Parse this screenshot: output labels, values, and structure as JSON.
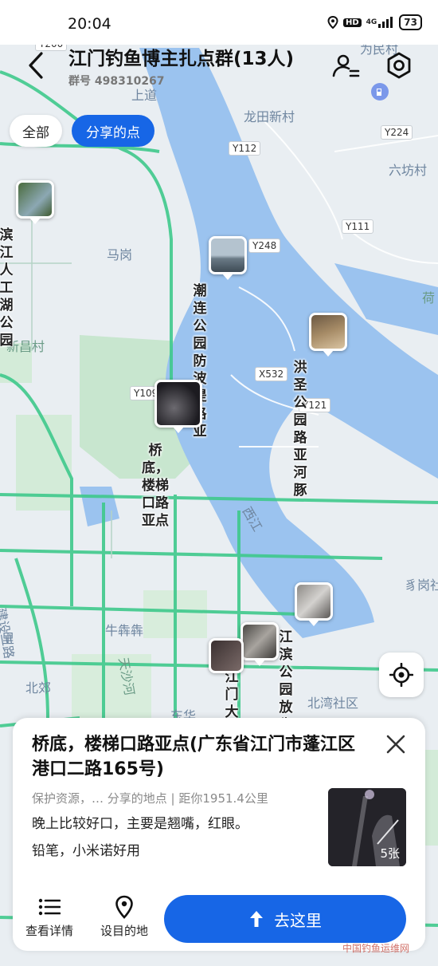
{
  "status_bar": {
    "time": "20:04",
    "network": "4G",
    "battery": "73"
  },
  "header": {
    "title": "江门钓鱼博主扎点群(13人)",
    "group_number": "群号 498310267"
  },
  "filters": {
    "all": "全部",
    "shared": "分享的点",
    "active": "shared"
  },
  "map_labels": {
    "y200": "Y200",
    "weimin": "为民村",
    "shangdao": "上道",
    "longtian": "龙田新村",
    "liufang": "六坊村",
    "y112": "Y112",
    "y224": "Y224",
    "y111": "Y111",
    "y248": "Y248",
    "magang": "马岗",
    "he": "荷",
    "xinchang": "新昌村",
    "x532": "X532",
    "y121": "Y121",
    "y109": "Y109",
    "xijiang": "西江",
    "gangshe": "豸岗社",
    "jianshe": "建设三路",
    "niuchou": "牛犇犇",
    "li": "里",
    "beijiao": "北郊",
    "tiansha": "天沙河",
    "beiwan": "北湾社区",
    "dongjiang": "东华"
  },
  "markers": [
    {
      "label": "滨江人工湖\n公园"
    },
    {
      "label": "潮连公园防\n波堤路亚"
    },
    {
      "label": "洪圣公园路\n亚河豚"
    },
    {
      "label": "桥底，楼梯\n口路亚点"
    },
    {
      "label": "江滨公园放\n生台路亚"
    },
    {
      "label": "江门大桥底\n路亚"
    }
  ],
  "card": {
    "title": "桥底，楼梯口路亚点(广东省江门市蓬江区港口二路165号)",
    "meta": "保护资源，… 分享的地点 | 距你1951.4公里",
    "description": "晚上比较好口，主要是翘嘴，红眼。\n铅笔，小米诺好用",
    "photo_count": "5张",
    "details_label": "查看详情",
    "destination_label": "设目的地",
    "go_label": "去这里"
  },
  "watermark": "中国钓鱼运维网",
  "colors": {
    "accent": "#1766e6",
    "water": "#9bc3ef",
    "road": "#3fc98c",
    "land": "#e9eef2",
    "park": "#c8e6cf"
  }
}
